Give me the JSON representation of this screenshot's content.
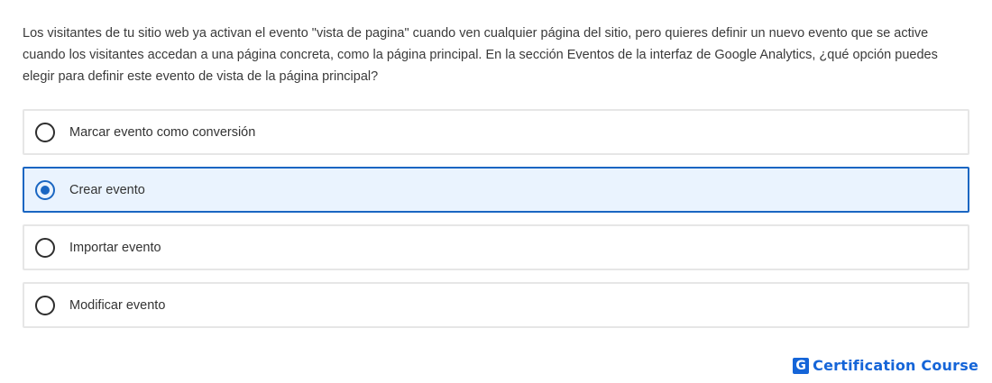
{
  "question": {
    "text": "Los visitantes de tu sitio web ya activan el evento \"vista de pagina\" cuando ven cualquier página del sitio, pero quieres definir un nuevo evento que se active cuando los visitantes accedan a una página concreta, como la página principal. En la sección Eventos de la interfaz de Google Analytics, ¿qué opción puedes elegir para definir este evento de vista de la página principal?"
  },
  "options": [
    {
      "label": "Marcar evento como conversión",
      "selected": false
    },
    {
      "label": "Crear evento",
      "selected": true
    },
    {
      "label": "Importar evento",
      "selected": false
    },
    {
      "label": "Modificar evento",
      "selected": false
    }
  ],
  "brand": {
    "logo_letter": "G",
    "text": "Certification Course",
    "color": "#1565d8"
  },
  "colors": {
    "selected_border": "#1a66c2",
    "selected_background": "#eaf3fe",
    "option_border": "#e6e6e6"
  }
}
